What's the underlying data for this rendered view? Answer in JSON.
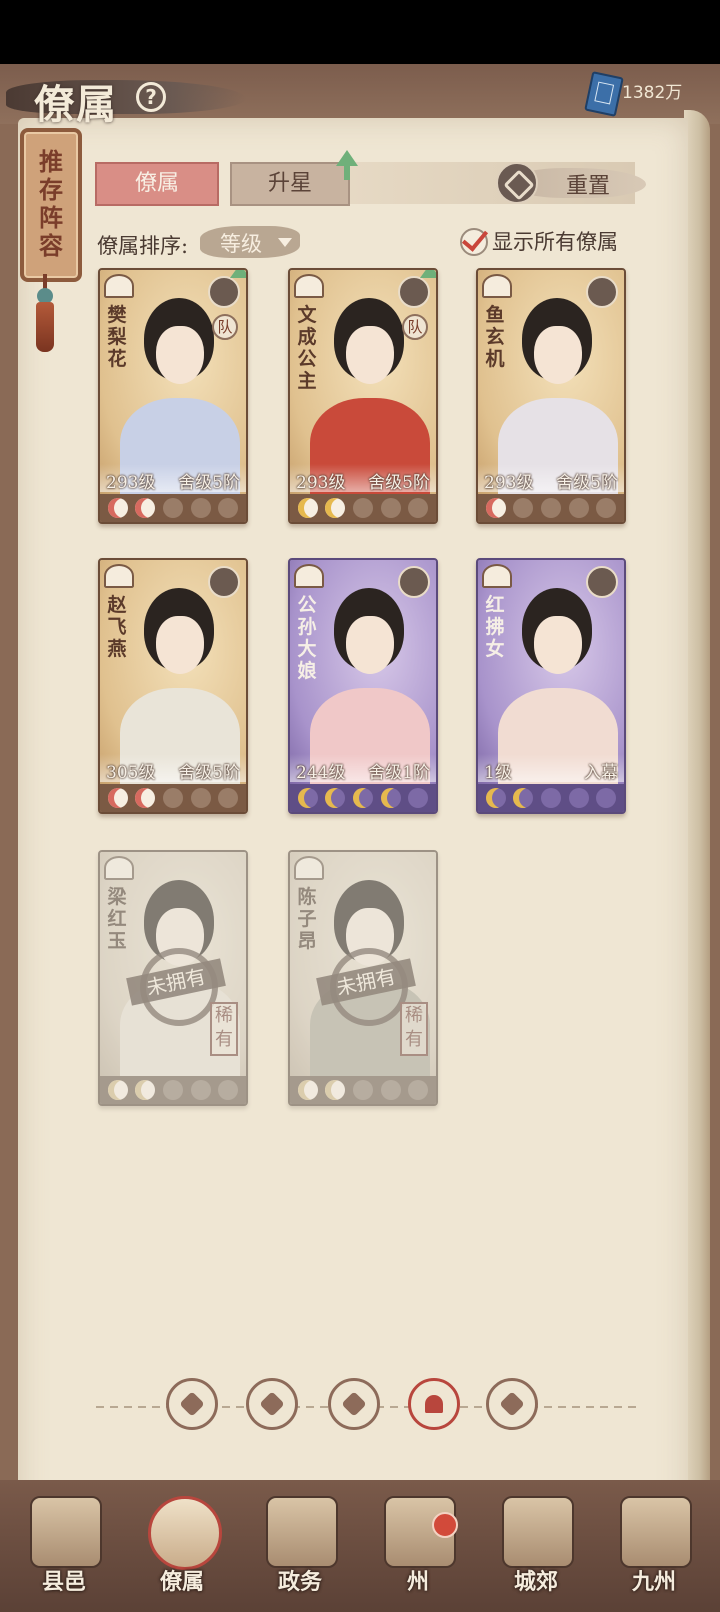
{
  "header": {
    "title": "僚属",
    "currency_value": "1382万",
    "help_icon": "question-icon",
    "currency_icon": "book-icon"
  },
  "plaque": {
    "label": "推存阵容"
  },
  "tabs": [
    {
      "label": "僚属",
      "active": true
    },
    {
      "label": "升星",
      "active": false
    }
  ],
  "reset": {
    "label": "重置"
  },
  "sort": {
    "label": "僚属排序:",
    "value": "等级"
  },
  "show_all": {
    "label": "显示所有僚属",
    "checked": true
  },
  "cards": [
    {
      "name": "樊梨花",
      "level": "293级",
      "rank": "舍级5阶",
      "theme": "gold",
      "team": "队",
      "upgrade": true,
      "stars": 2,
      "star_color": "red",
      "robe": "#c8d0e6"
    },
    {
      "name": "文成公主",
      "level": "293级",
      "rank": "舍级5阶",
      "theme": "gold",
      "team": "队",
      "upgrade": true,
      "stars": 2,
      "star_color": "gold",
      "robe": "#c94a3a"
    },
    {
      "name": "鱼玄机",
      "level": "293级",
      "rank": "舍级5阶",
      "theme": "gold",
      "team": "",
      "upgrade": false,
      "stars": 1,
      "star_color": "red",
      "robe": "#e6e1e6"
    },
    {
      "name": "赵飞燕",
      "level": "305级",
      "rank": "舍级5阶",
      "theme": "gold",
      "team": "",
      "upgrade": false,
      "stars": 2,
      "star_color": "red",
      "robe": "#e9e4d8"
    },
    {
      "name": "公孙大娘",
      "level": "244级",
      "rank": "舍级1阶",
      "theme": "purple",
      "team": "",
      "upgrade": false,
      "stars": 4,
      "star_color": "gold",
      "robe": "#f0c8c8"
    },
    {
      "name": "红拂女",
      "level": "1级",
      "rank": "入幕",
      "theme": "purple",
      "team": "",
      "upgrade": false,
      "stars": 2,
      "star_color": "gold",
      "robe": "#f1dcd2"
    },
    {
      "name": "梁红玉",
      "locked": true,
      "locked_label": "未拥有",
      "rarity": "稀有",
      "theme": "locked",
      "stars": 2,
      "star_color": "gold",
      "robe": "#e8dcd0"
    },
    {
      "name": "陈子昂",
      "locked": true,
      "locked_label": "未拥有",
      "rarity": "稀有",
      "theme": "locked",
      "stars": 2,
      "star_color": "gold",
      "robe": "#a8a98f"
    }
  ],
  "filters": [
    {
      "icon": "diamond-icon",
      "active": false
    },
    {
      "icon": "scholar-icon",
      "active": false
    },
    {
      "icon": "beast-icon",
      "active": false
    },
    {
      "icon": "fan-icon",
      "active": true
    },
    {
      "icon": "lion-icon",
      "active": false
    }
  ],
  "bottom_nav": [
    {
      "label": "县邑",
      "icon": "town-icon",
      "active": false
    },
    {
      "label": "僚属",
      "icon": "retainer-icon",
      "active": true
    },
    {
      "label": "政务",
      "icon": "scroll-icon",
      "active": false
    },
    {
      "label": "州",
      "icon": "mountain-icon",
      "active": false,
      "badge": true
    },
    {
      "label": "城郊",
      "icon": "suburb-icon",
      "active": false
    },
    {
      "label": "九州",
      "icon": "map-icon",
      "active": false
    }
  ]
}
